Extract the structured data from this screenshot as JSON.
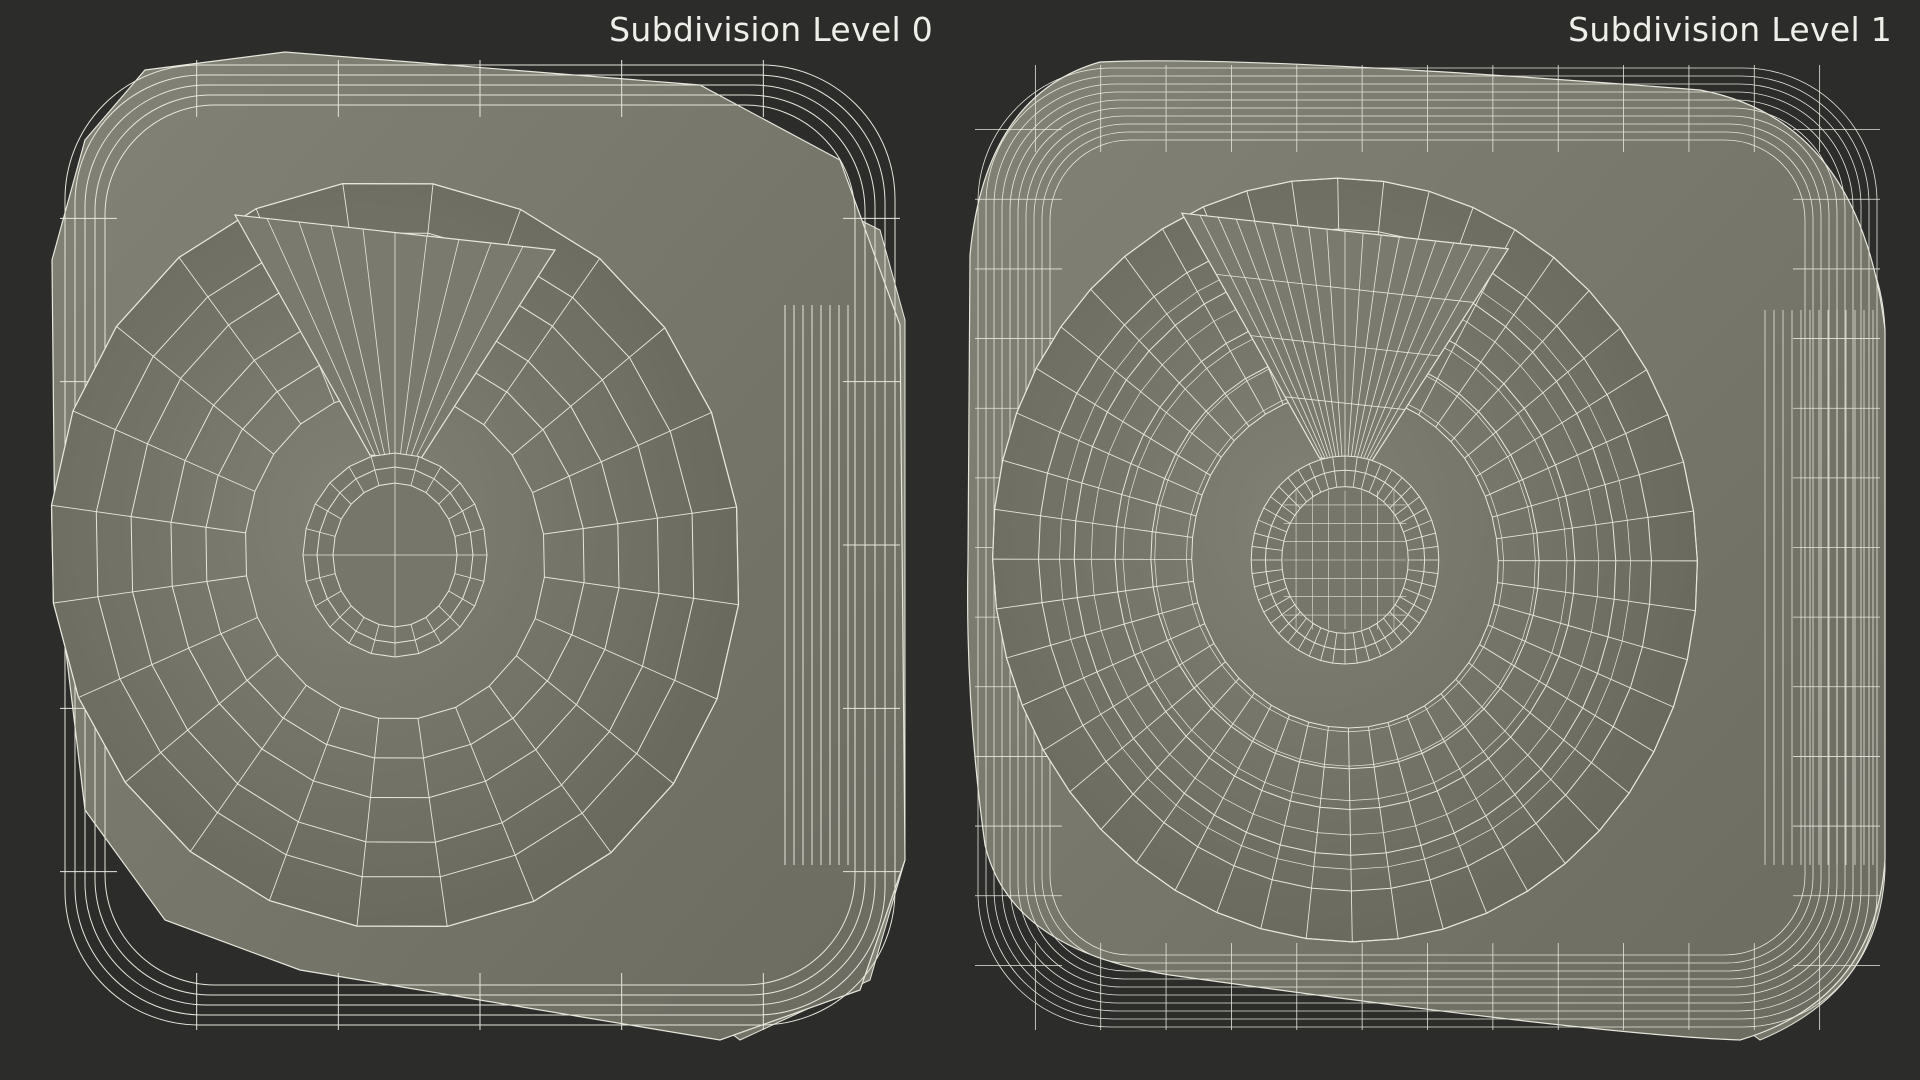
{
  "panels": [
    {
      "caption": "Subdivision Level 0",
      "wire_density": "low"
    },
    {
      "caption": "Subdivision Level 1",
      "wire_density": "high"
    }
  ],
  "colors": {
    "background": "#2c2c2b",
    "surface": "#76766a",
    "wire": "#e6e6dc",
    "caption": "#efefe9"
  }
}
